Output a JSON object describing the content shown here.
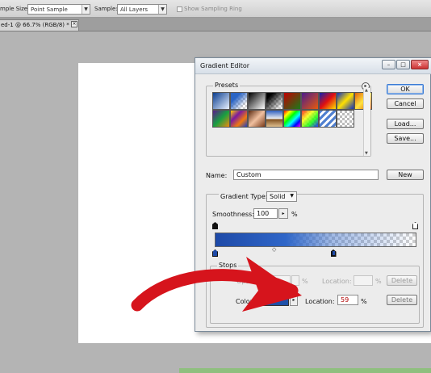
{
  "options_bar": {
    "sample_size_label": "mple Size:",
    "sample_size_value": "Point Sample",
    "sample_label": "Sample:",
    "sample_value": "All Layers",
    "show_ring_label": "Show Sampling Ring"
  },
  "document_tab": {
    "title": "ed-1 @ 66.7% (RGB/8) *",
    "close_glyph": "×"
  },
  "dialog": {
    "title": "Gradient Editor",
    "window_buttons": [
      "–",
      "□",
      "×"
    ],
    "presets_label": "Presets",
    "presets_menu_glyph": "▸",
    "presets": [
      {
        "name": "blue-white",
        "bg": "linear-gradient(135deg,#0a3d8f,#e8f0ff)"
      },
      {
        "name": "blue-transparent",
        "bg": "linear-gradient(135deg,#2a64c4 30%,rgba(255,255,255,0) 80%),repeating-conic-gradient(#ccc 0% 25%,#fff 0% 50%) 0 0/6px 6px"
      },
      {
        "name": "black-white",
        "bg": "linear-gradient(135deg,#000,#fff)"
      },
      {
        "name": "black-transparent",
        "bg": "linear-gradient(135deg,#000 20%,rgba(255,255,255,0) 90%),repeating-conic-gradient(#ccc 0% 25%,#fff 0% 50%) 0 0/6px 6px"
      },
      {
        "name": "red-green",
        "bg": "linear-gradient(135deg,#c00000,#1a7a1a)"
      },
      {
        "name": "violet-orange",
        "bg": "linear-gradient(135deg,#4b1c8c,#e85a0c)"
      },
      {
        "name": "blue-red-yellow",
        "bg": "linear-gradient(135deg,#1020b0,#e01010,#ffe000)"
      },
      {
        "name": "blue-yellow-blue",
        "bg": "linear-gradient(135deg,#1030c0,#ffe000,#1030c0)"
      },
      {
        "name": "orange-yellow-orange",
        "bg": "linear-gradient(135deg,#e0600a,#ffe440,#e0600a)"
      },
      {
        "name": "violet-green-orange",
        "bg": "linear-gradient(135deg,#5a1a8c,#18a040,#f08a10)"
      },
      {
        "name": "yellow-violet-orange-blue",
        "bg": "linear-gradient(135deg,#ffd000,#7a1aa0,#f07a10,#2040c0)"
      },
      {
        "name": "copper",
        "bg": "linear-gradient(135deg,#5a2a10,#f0c0a0,#7a3a18)"
      },
      {
        "name": "chrome",
        "bg": "linear-gradient(180deg,#3060c0,#f0f0f0 50%,#805020 55%,#e0c090)"
      },
      {
        "name": "spectrum",
        "bg": "linear-gradient(135deg,#ff0000,#ffff00,#00ff00,#00ffff,#0000ff,#ff00ff)"
      },
      {
        "name": "transparent-rainbow",
        "bg": "linear-gradient(135deg,rgba(255,0,0,0.8),rgba(255,255,0,0.8),rgba(0,255,0,0.8),rgba(0,0,255,0.8)),repeating-conic-gradient(#ccc 0% 25%,#fff 0% 50%) 0 0/6px 6px"
      },
      {
        "name": "transparent-stripes",
        "bg": "repeating-linear-gradient(135deg,#5080d0 0 3px,#ffffff 3px 6px)"
      },
      {
        "name": "transparent-checks",
        "bg": "repeating-conic-gradient(#bbb 0% 25%,#fff 0% 50%) 0 0/6px 6px"
      }
    ],
    "buttons": {
      "ok": "OK",
      "cancel": "Cancel",
      "load": "Load...",
      "save": "Save...",
      "new": "New"
    },
    "name_label": "Name:",
    "name_value": "Custom",
    "gradient_type_label": "Gradient Type:",
    "gradient_type_value": "Solid",
    "smoothness_label": "Smoothness:",
    "smoothness_value": "100",
    "smoothness_unit": "%",
    "stops_label": "Stops",
    "opacity_label": "Opacity:",
    "opacity_unit": "%",
    "opacity_location_label": "Location:",
    "opacity_location_unit": "%",
    "delete_label": "Delete",
    "color_label": "Color:",
    "color_value": "#1e50a8",
    "color_location_label": "Location:",
    "color_location_value": "59",
    "color_location_unit": "%",
    "midpoint_glyph": "◇",
    "selected_color_stop": 0.59
  },
  "annotation": {
    "arrow_color": "#d6141c"
  }
}
